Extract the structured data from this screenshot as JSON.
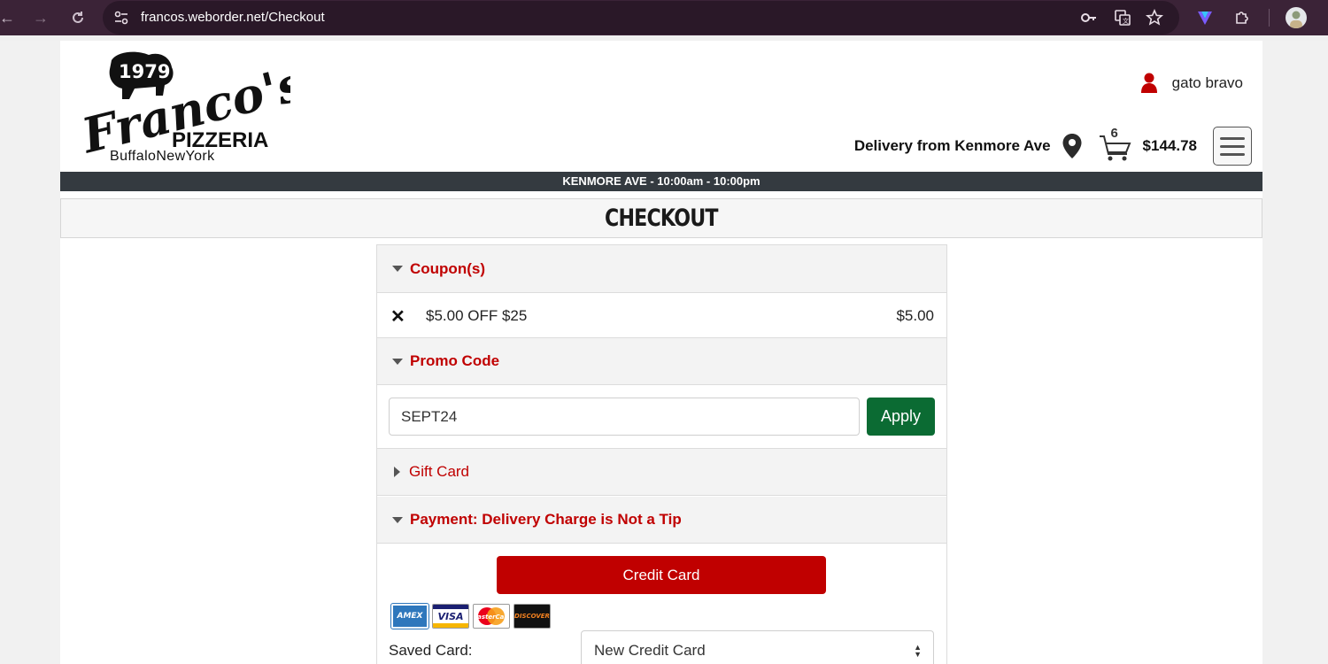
{
  "browser": {
    "url": "francos.weborder.net/Checkout"
  },
  "header": {
    "logo": {
      "year": "1979",
      "brand": "Franco's",
      "subtitle": "PIZZERIA",
      "tagline": "BuffaloNewYork"
    },
    "user_name": "gato bravo",
    "delivery_text": "Delivery from Kenmore Ave",
    "cart_count": "6",
    "cart_total": "$144.78"
  },
  "hours_bar": "KENMORE AVE - 10:00am - 10:00pm",
  "page_title": "CHECKOUT",
  "sections": {
    "coupons": {
      "title": "Coupon(s)",
      "items": [
        {
          "remove": "✕",
          "name": "$5.00 OFF $25",
          "amount": "$5.00"
        }
      ]
    },
    "promo": {
      "title": "Promo Code",
      "input_value": "SEPT24",
      "apply_label": "Apply"
    },
    "gift_card": {
      "title": "Gift Card"
    },
    "payment": {
      "title": "Payment: Delivery Charge is Not a Tip",
      "credit_card_label": "Credit Card",
      "card_logos": [
        "AMEX",
        "VISA",
        "MasterCard",
        "DISCOVER"
      ],
      "saved_card_label": "Saved Card:",
      "saved_card_value": "New Credit Card"
    }
  },
  "colors": {
    "chrome_bg": "#3b2337",
    "accent_red": "#c00000",
    "apply_green": "#0b6b33",
    "hours_bar_bg": "#343a40"
  }
}
